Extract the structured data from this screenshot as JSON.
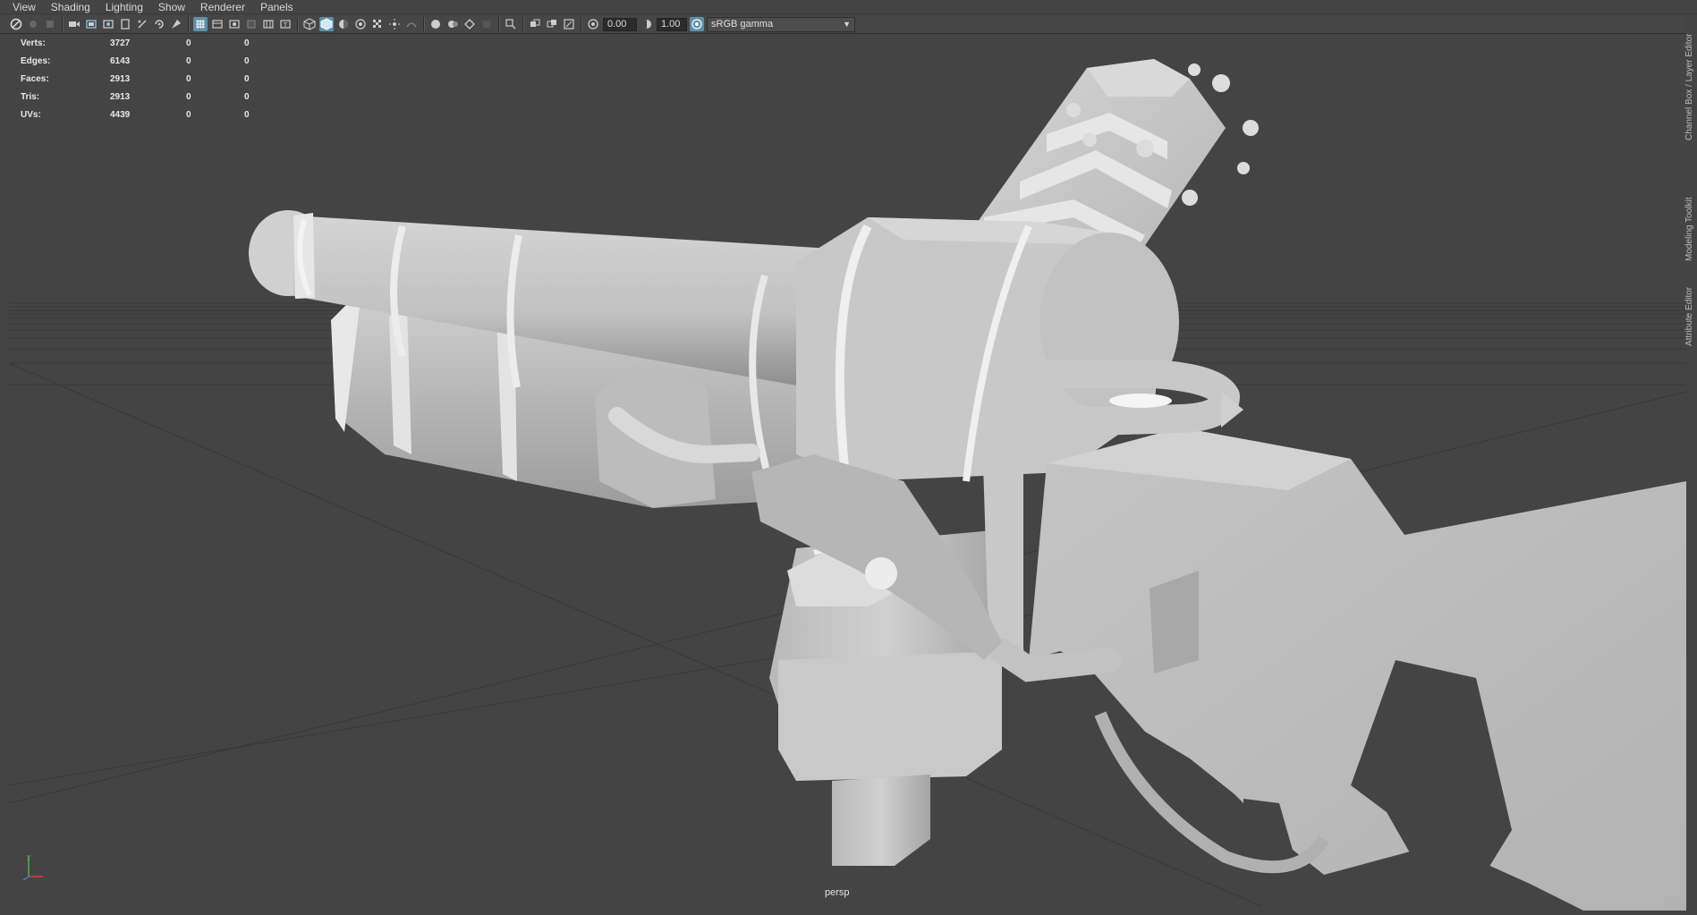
{
  "menubar": {
    "items": [
      "View",
      "Shading",
      "Lighting",
      "Show",
      "Renderer",
      "Panels"
    ]
  },
  "toolbar": {
    "exposure_value": "0.00",
    "gamma_value": "1.00",
    "color_space": "sRGB gamma",
    "icons": [
      "select-camera-icon",
      "camera-attributes-icon",
      "bookmark-icon",
      "image-plane-icon",
      "film-gate-icon",
      "resolution-gate-icon",
      "gate-mask-icon",
      "field-chart-icon",
      "safe-action-icon",
      "safe-title-icon",
      "grid-icon",
      "wireframe-icon",
      "smooth-shade-icon",
      "default-material-icon",
      "wireframe-on-shaded-icon",
      "xray-icon",
      "textured-icon",
      "lights-icon",
      "shadows-icon",
      "screen-space-ao-icon",
      "motion-blur-icon",
      "multisample-aa-icon",
      "depth-of-field-icon",
      "isolate-select-icon",
      "xray-joints-icon",
      "exposure-icon",
      "gamma-icon",
      "color-management-icon"
    ]
  },
  "hud": {
    "rows": [
      {
        "label": "Verts:",
        "v1": "3727",
        "v2": "0",
        "v3": "0"
      },
      {
        "label": "Edges:",
        "v1": "6143",
        "v2": "0",
        "v3": "0"
      },
      {
        "label": "Faces:",
        "v1": "2913",
        "v2": "0",
        "v3": "0"
      },
      {
        "label": "Tris:",
        "v1": "2913",
        "v2": "0",
        "v3": "0"
      },
      {
        "label": "UVs:",
        "v1": "4439",
        "v2": "0",
        "v3": "0"
      }
    ]
  },
  "viewport": {
    "camera_label": "persp",
    "background": "#444444",
    "model_color": "#c9c9c9"
  },
  "side_panel": {
    "tabs": [
      "Channel Box / Layer Editor",
      "Modeling Toolkit",
      "Attribute Editor"
    ]
  }
}
